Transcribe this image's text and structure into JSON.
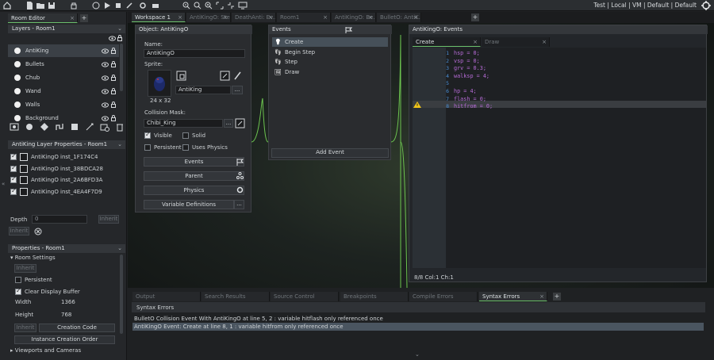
{
  "toolbar": {
    "right_text": "Test | Local | VM | Default | Default"
  },
  "left": {
    "room_editor_tab": "Room Editor",
    "layers_title": "Layers - Room1",
    "layers": [
      "AntiKing",
      "Bullets",
      "Chub",
      "Wand",
      "Walls",
      "Background"
    ],
    "layer_props_title": "AntiKing Layer Properties - Room1",
    "instances": [
      {
        "obj": "AntiKingO",
        "id": "inst_1F174C4"
      },
      {
        "obj": "AntiKingO",
        "id": "inst_38BDCA28"
      },
      {
        "obj": "AntiKingO",
        "id": "inst_2A6BFD3A"
      },
      {
        "obj": "AntiKingO",
        "id": "inst_4EA4F7D9"
      }
    ],
    "depth_label": "Depth",
    "depth_value": "0",
    "inherit": "Inherit",
    "props_title": "Properties - Room1",
    "room_settings": "Room Settings",
    "persistent": "Persistent",
    "clear_display": "Clear Display Buffer",
    "width_label": "Width",
    "width_value": "1366",
    "height_label": "Height",
    "height_value": "768",
    "creation_code": "Creation Code",
    "instance_order": "Instance Creation Order",
    "viewports": "Viewports and Cameras"
  },
  "workspace_tabs": [
    "Workspace 1",
    "AntiKingO: Step",
    "DeathAnti: Ev...",
    "Room1",
    "AntiKingO: Be...",
    "BulletO: AntiK..."
  ],
  "object": {
    "title": "Object: AntiKingO",
    "name_label": "Name:",
    "name": "AntiKingO",
    "sprite_label": "Sprite:",
    "sprite_size": "24 x 32",
    "sprite_name": "AntiKing",
    "sprite_more": "...",
    "mask_label": "Collision Mask:",
    "mask": "Chibi_King",
    "visible": "Visible",
    "solid": "Solid",
    "persistent": "Persistent",
    "uses_physics": "Uses Physics",
    "events_btn": "Events",
    "parent_btn": "Parent",
    "physics_btn": "Physics",
    "variables_btn": "Variable Definitions",
    "variables_more": "..."
  },
  "events": {
    "title": "Events",
    "items": [
      "Create",
      "Begin Step",
      "Step",
      "Draw"
    ],
    "add": "Add Event"
  },
  "code": {
    "title": "AntiKingO: Events",
    "tabs": [
      "Create",
      "Draw"
    ],
    "lines": [
      "hsp = 0;",
      "vsp = 0;",
      "grv = 0.3;",
      "walksp = 4;",
      "",
      "hp = 4;",
      "flash = 0;",
      "hitfrom = 0;"
    ],
    "status": "8/8 Col:1 Ch:1"
  },
  "bottom": {
    "tabs": [
      "Output",
      "Search Results",
      "Source Control",
      "Breakpoints",
      "Compile Errors",
      "Syntax Errors"
    ],
    "header": "Syntax Errors",
    "messages": [
      "BulletO Collision Event With AntiKingO at line 5, 2 : variable hitflash only referenced once",
      "AntiKingO Event: Create at line 8, 1 : variable hitfrom only referenced once"
    ]
  }
}
